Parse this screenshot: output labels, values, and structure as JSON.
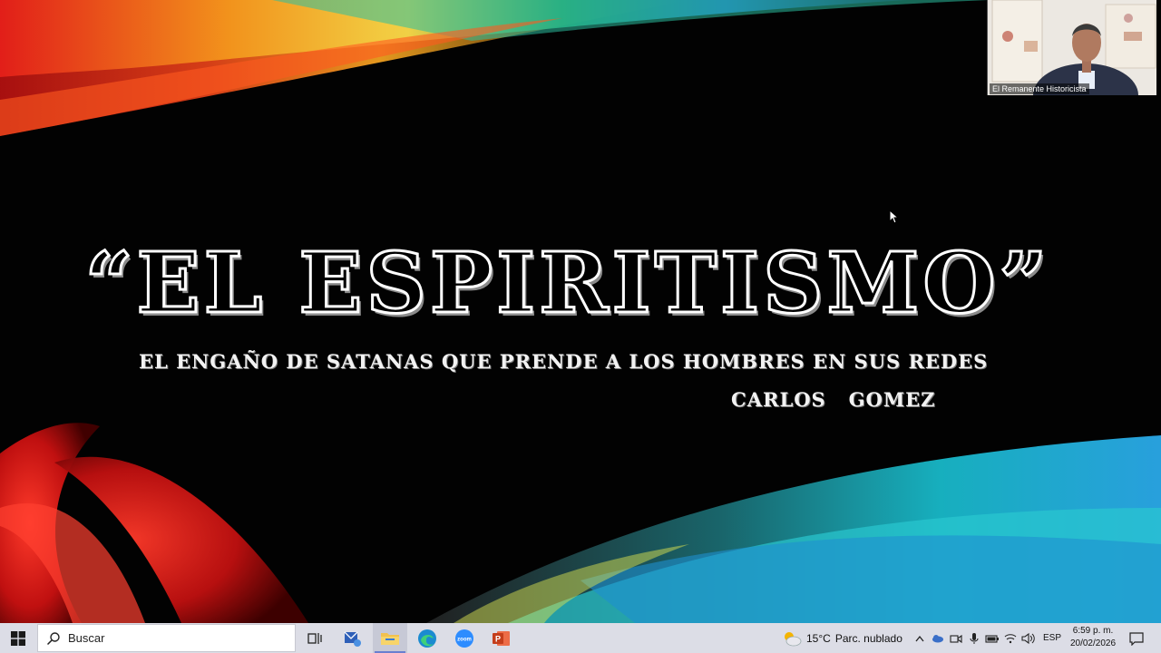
{
  "slide": {
    "title": "“EL ESPIRITISMO”",
    "subtitle": "EL ENGAÑO DE SATANAS QUE PRENDE A LOS HOMBRES EN SUS REDES",
    "author": "CARLOS   GOMEZ"
  },
  "video": {
    "participant_name": "El Remanente Historicista"
  },
  "taskbar": {
    "start_icon": "windows-logo-icon",
    "search_placeholder": "Buscar",
    "apps": [
      {
        "name": "task-view",
        "icon": "task-view-icon"
      },
      {
        "name": "mail-app",
        "icon": "mail-icon"
      },
      {
        "name": "file-explorer",
        "icon": "folder-icon",
        "active": true
      },
      {
        "name": "edge",
        "icon": "edge-icon"
      },
      {
        "name": "zoom",
        "icon": "zoom-icon",
        "label": "zoom"
      },
      {
        "name": "powerpoint",
        "icon": "powerpoint-icon",
        "label": "P"
      }
    ],
    "weather": {
      "temp": "15°C",
      "condition": "Parc. nublado"
    },
    "language": "ESP",
    "time": "6:59 p. m.",
    "date": "20/02/2026"
  },
  "colors": {
    "taskbar_bg": "#dcdde6",
    "slide_bg": "#020202",
    "accent_red": "#e0241a",
    "accent_cyan": "#20b8d8",
    "accent_orange": "#f29a1a"
  }
}
